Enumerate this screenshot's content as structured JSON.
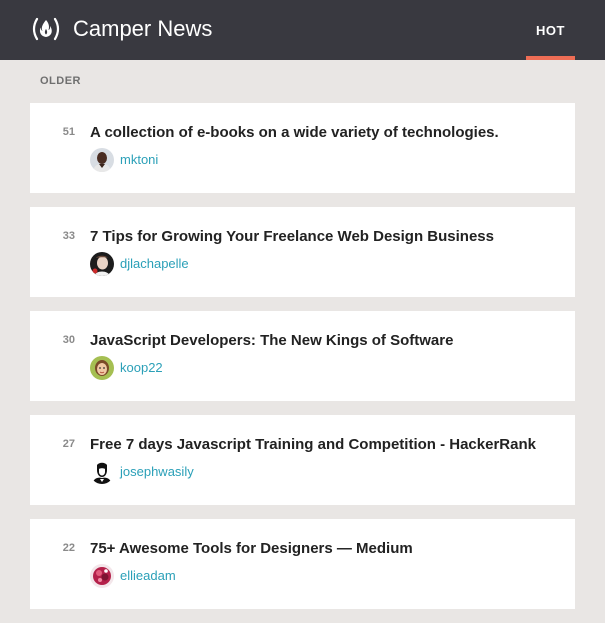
{
  "app": {
    "title": "Camper News",
    "logo_icon": "freecodecamp-fire-icon"
  },
  "nav": {
    "tabs": [
      {
        "label": "HOT",
        "active": true
      }
    ]
  },
  "colors": {
    "header_bg": "#393940",
    "accent": "#ee6d55",
    "link": "#2ba0b8",
    "page_bg": "#e9e6e4"
  },
  "section": {
    "label": "OLDER"
  },
  "stories": [
    {
      "points": "51",
      "title": "A collection of e-books on a wide variety of technologies.",
      "author": "mktoni"
    },
    {
      "points": "33",
      "title": "7 Tips for Growing Your Freelance Web Design Business",
      "author": "djlachapelle"
    },
    {
      "points": "30",
      "title": "JavaScript Developers: The New Kings of Software",
      "author": "koop22"
    },
    {
      "points": "27",
      "title": "Free 7 days Javascript Training and Competition - HackerRank",
      "author": "josephwasily"
    },
    {
      "points": "22",
      "title": "75+ Awesome Tools for Designers — Medium",
      "author": "ellieadam"
    }
  ]
}
